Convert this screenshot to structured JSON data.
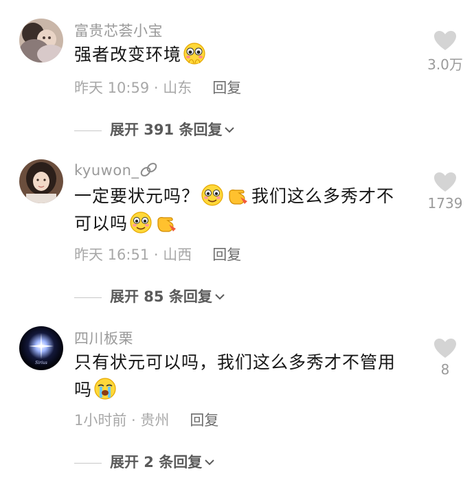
{
  "comments": [
    {
      "username": "富贵芯荟小宝",
      "text_parts": [
        "强者改变环境"
      ],
      "time_location": "昨天 10:59 · 山东",
      "reply_label": "回复",
      "like_count": "3.0万",
      "expand_label": "展开 391 条回复"
    },
    {
      "username": "kyuwon_",
      "text_parts": [
        "一定要状元吗？",
        "我们这么多秀才不",
        "可以吗"
      ],
      "time_location": "昨天 16:51 · 山西",
      "reply_label": "回复",
      "like_count": "1739",
      "expand_label": "展开 85 条回复"
    },
    {
      "username": "四川板栗",
      "text_parts": [
        "只有状元可以吗，我们这么多秀才不管用",
        "吗"
      ],
      "time_location": "1小时前 · 贵州",
      "reply_label": "回复",
      "like_count": "8",
      "expand_label": "展开 2 条回复"
    }
  ],
  "avatar_label": "Sirius",
  "icons": {
    "heart": "heart-icon",
    "chevron": "chevron-down-icon",
    "link": "link-icon",
    "emoji_shy": "shy-face-emoji",
    "emoji_smile": "smile-face-emoji",
    "emoji_point": "pointing-hand-emoji",
    "emoji_cry": "crying-face-emoji"
  },
  "colors": {
    "username": "#9a9a9a",
    "text": "#161616",
    "meta": "#a8a8a8",
    "heart": "#d4d4d4"
  }
}
